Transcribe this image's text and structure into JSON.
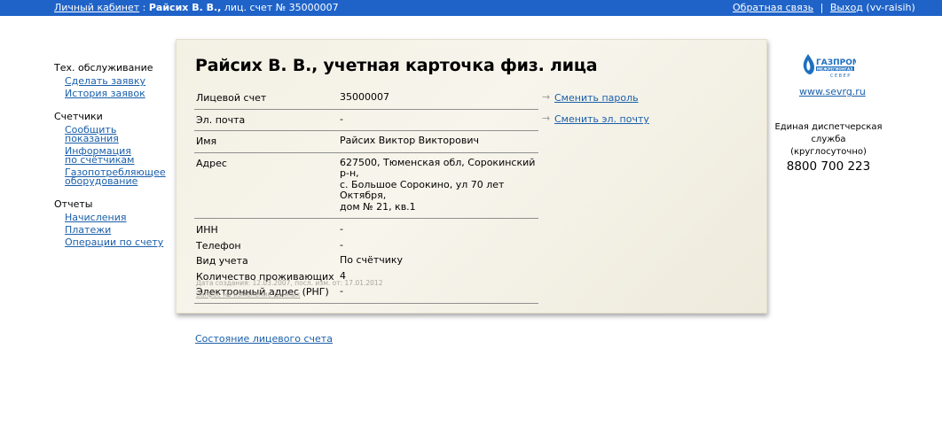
{
  "topbar": {
    "cabinet_label": "Личный кабинет",
    "colon": ":",
    "user_name": "Райсих В. В.,",
    "account_text": "лиц. счет № 35000007",
    "feedback_label": "Обратная связь",
    "divider": "|",
    "logout_label": "Выход",
    "login_hint": "(vv-raisih)"
  },
  "nav": {
    "groups": [
      {
        "title": "Тех. обслуживание",
        "items": [
          "Сделать заявку",
          "История заявок"
        ]
      },
      {
        "title": "Счетчики",
        "items": [
          "Сообщить показания",
          "Информация",
          "по счётчикам",
          "Газопотребляющее",
          "оборудование"
        ]
      },
      {
        "title": "Отчеты",
        "items": [
          "Начисления",
          "Платежи",
          "Операции по счету"
        ]
      }
    ]
  },
  "card": {
    "title": "Райсих В. В., учетная карточка физ. лица",
    "rows": [
      {
        "label": "Лицевой счет",
        "value": "35000007"
      },
      {
        "label": "Эл. почта",
        "value": "-"
      },
      {
        "label": "Имя",
        "value": "Райсих Виктор Викторович"
      },
      {
        "label": "Адрес",
        "value_lines": [
          "627500, Тюменская обл, Сорокинский р-н,",
          "с. Большое Сорокино, ул 70 лет Октября,",
          "дом № 21, кв.1"
        ]
      },
      {
        "label": "ИНН",
        "value": "-"
      },
      {
        "label": "Телефон",
        "value": "-"
      },
      {
        "label": "Вид учета",
        "value": "По счётчику"
      },
      {
        "label": "Количество проживающих",
        "value": "4"
      },
      {
        "label": "Электронный адрес (РНГ)",
        "value": "-"
      }
    ],
    "meta_text": "Дата создания: 12.03.2007, посл. изм. от: 17.01.2012",
    "meta_link": "Запрос на изменение данных",
    "actions": [
      {
        "arrow": "→",
        "label": "Сменить пароль"
      },
      {
        "arrow": "→",
        "label": "Сменить эл. почту"
      }
    ]
  },
  "bottom_link": "Состояние лицевого счета",
  "right": {
    "logo_text_top": "ГАЗПРОМ",
    "logo_text_mid": "МЕЖРЕГИОНГАЗ",
    "logo_text_bottom": "СЕВЕР",
    "site": "www.sevrg.ru",
    "dispatch_line1": "Единая диспетчерская",
    "dispatch_line2": "служба (круглосуточно)",
    "phone": "8800 700 223"
  },
  "colors": {
    "topbar": "#1f63c8",
    "link": "#1a5faa",
    "card_bg": "#f3f0e4",
    "logo_blue": "#1e6fc0"
  },
  "icons": [
    "arrow-right-icon",
    "gazprom-logo-icon"
  ]
}
